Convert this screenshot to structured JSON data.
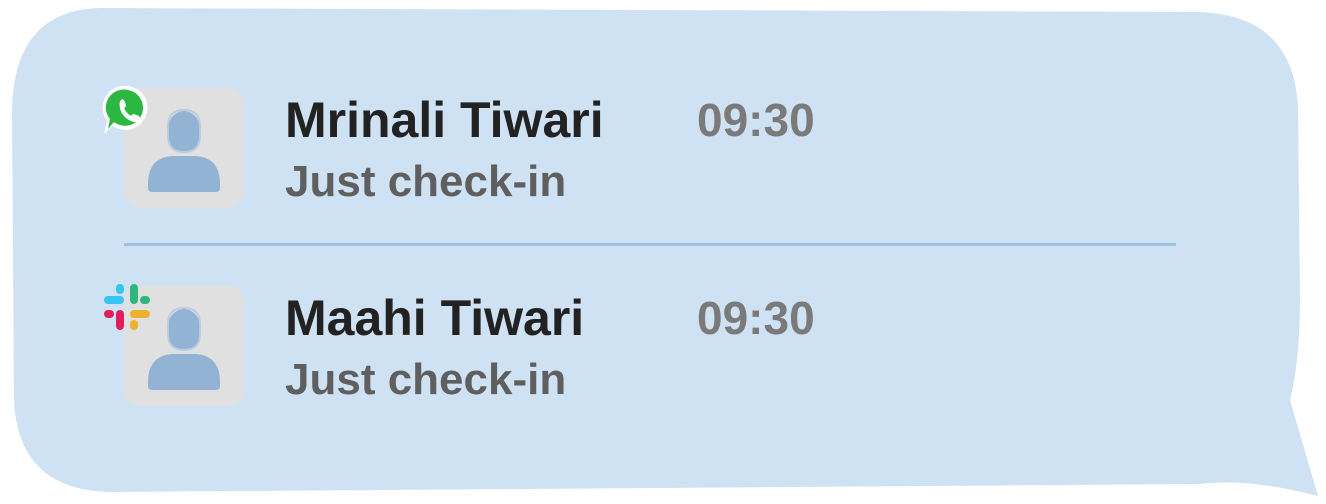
{
  "colors": {
    "bubble": "#cfe2f3",
    "divider": "#9dc1e0",
    "avatar_bg": "#e0e0e0",
    "avatar_figure": "#93b3d4",
    "name": "#222222",
    "time": "#7a7a7a",
    "message": "#5f5f5f"
  },
  "notifications": [
    {
      "app_icon": "whatsapp-icon",
      "avatar_icon": "user-avatar-icon",
      "sender": "Mrinali Tiwari",
      "time": "09:30",
      "message": "Just check-in"
    },
    {
      "app_icon": "slack-icon",
      "avatar_icon": "user-avatar-icon",
      "sender": "Maahi Tiwari",
      "time": "09:30",
      "message": "Just check-in"
    }
  ]
}
